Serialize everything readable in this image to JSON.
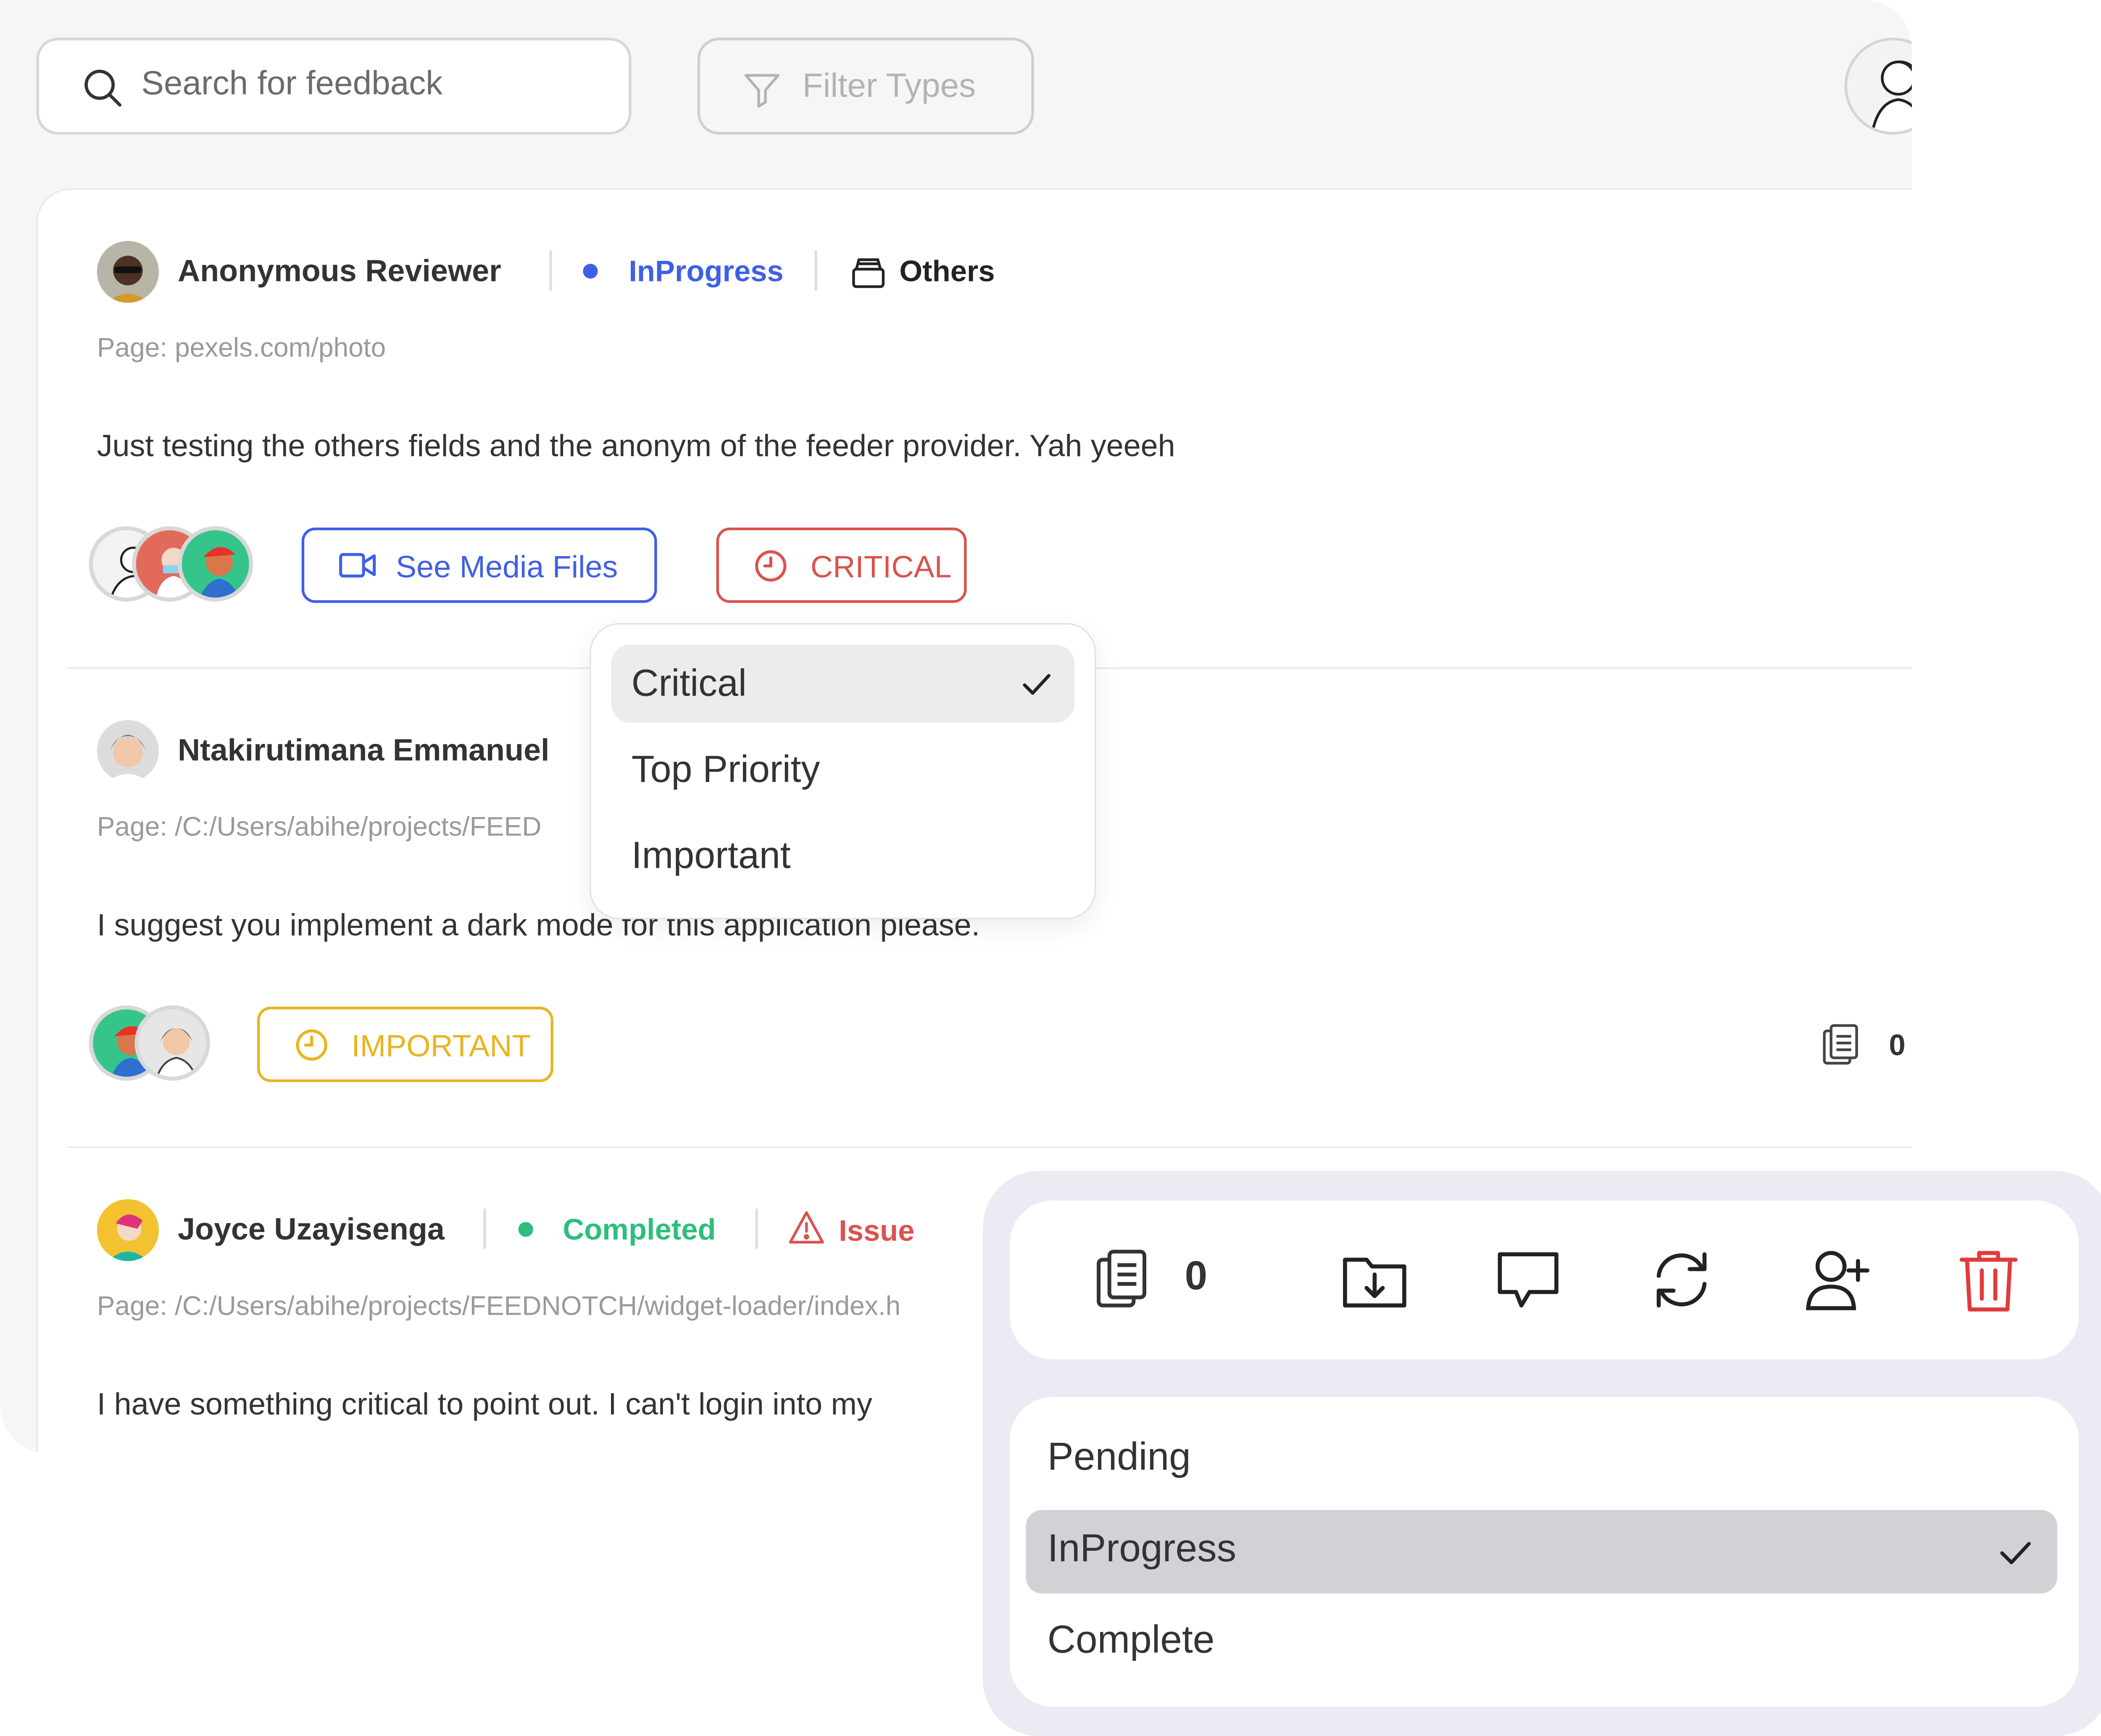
{
  "toolbar": {
    "search_placeholder": "Search for feedback",
    "filter_label": "Filter Types"
  },
  "feedback": [
    {
      "author": "Anonymous Reviewer",
      "status": "InProgress",
      "status_color": "#3f5fe6",
      "category": "Others",
      "page": "Page: pexels.com/photo",
      "message": "Just testing the others fields and the anonym of the feeder provider. Yah yeeeh",
      "media_label": "See Media Files",
      "priority": "CRITICAL",
      "priority_color": "#d9534f"
    },
    {
      "author": "Ntakirutimana Emmanuel",
      "page": "Page: /C:/Users/abihe/projects/FEED",
      "message": "I suggest you implement a dark mode for this application please.",
      "priority": "IMPORTANT",
      "priority_color": "#e9b420",
      "comment_count": "0"
    },
    {
      "author": "Joyce Uzayisenga",
      "status": "Completed",
      "status_color": "#2dbe7e",
      "category": "Issue",
      "category_color": "#d9534f",
      "page": "Page: /C:/Users/abihe/projects/FEEDNOTCH/widget-loader/index.h",
      "message": "I have something critical to point out. I can't login into my"
    }
  ],
  "priority_menu": {
    "options": [
      "Critical",
      "Top Priority",
      "Important"
    ],
    "selected": "Critical"
  },
  "actions": {
    "count": "0",
    "icons": [
      "clipboard-icon",
      "download-folder-icon",
      "comment-icon",
      "refresh-icon",
      "add-user-icon",
      "trash-icon"
    ]
  },
  "status_menu": {
    "options": [
      "Pending",
      "InProgress",
      "Complete"
    ],
    "selected": "InProgress"
  }
}
